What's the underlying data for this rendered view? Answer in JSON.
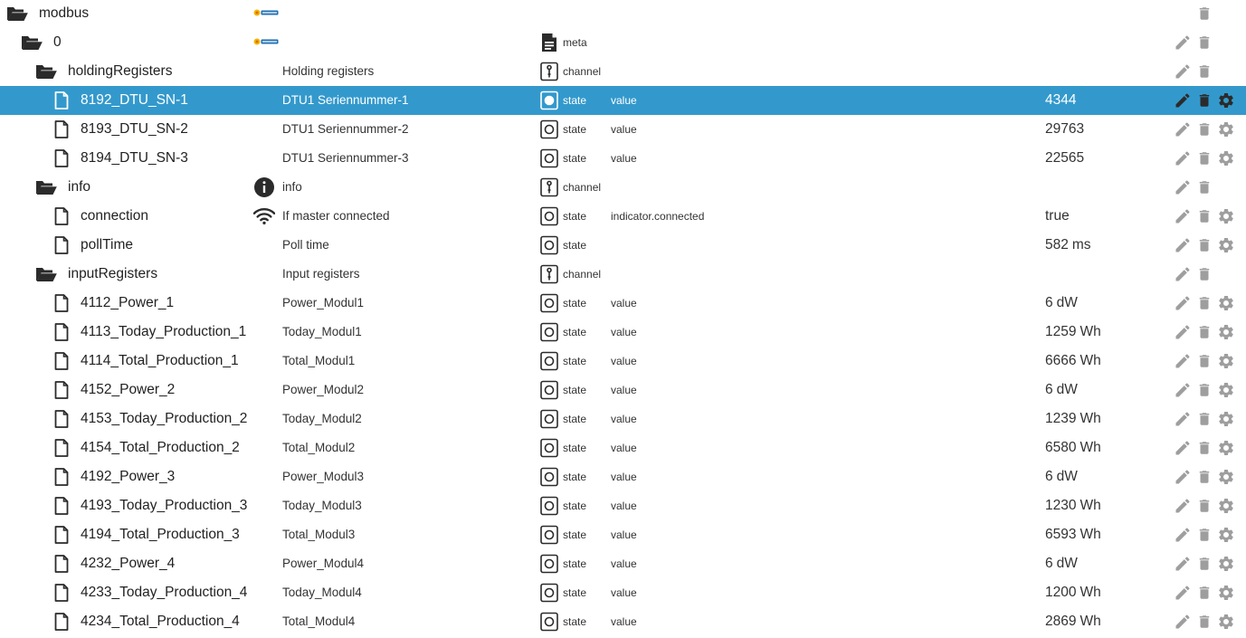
{
  "colors": {
    "selected_bg": "#3399cc",
    "icon": "#2b2b2b",
    "action_icon": "#9e9e9e"
  },
  "rows": [
    {
      "level": 0,
      "kind": "folder",
      "name": "modbus",
      "desc": "",
      "desc_icon": "modbus-logo",
      "type": "",
      "role": "",
      "value": "",
      "unit": "",
      "actions": [
        "delete"
      ],
      "selected": false
    },
    {
      "level": 1,
      "kind": "folder",
      "name": "0",
      "desc": "",
      "desc_icon": "modbus-logo",
      "type": "meta",
      "role": "",
      "value": "",
      "unit": "",
      "actions": [
        "edit",
        "delete"
      ],
      "selected": false
    },
    {
      "level": 2,
      "kind": "folder",
      "name": "holdingRegisters",
      "desc": "Holding registers",
      "desc_icon": "",
      "type": "channel",
      "role": "",
      "value": "",
      "unit": "",
      "actions": [
        "edit",
        "delete"
      ],
      "selected": false
    },
    {
      "level": 3,
      "kind": "file",
      "name": "8192_DTU_SN-1",
      "desc": "DTU1 Seriennummer-1",
      "desc_icon": "",
      "type": "state",
      "role": "value",
      "value": "4344",
      "unit": "",
      "actions": [
        "edit",
        "delete",
        "settings"
      ],
      "selected": true
    },
    {
      "level": 3,
      "kind": "file",
      "name": "8193_DTU_SN-2",
      "desc": "DTU1 Seriennummer-2",
      "desc_icon": "",
      "type": "state",
      "role": "value",
      "value": "29763",
      "unit": "",
      "actions": [
        "edit",
        "delete",
        "settings"
      ],
      "selected": false
    },
    {
      "level": 3,
      "kind": "file",
      "name": "8194_DTU_SN-3",
      "desc": "DTU1 Seriennummer-3",
      "desc_icon": "",
      "type": "state",
      "role": "value",
      "value": "22565",
      "unit": "",
      "actions": [
        "edit",
        "delete",
        "settings"
      ],
      "selected": false
    },
    {
      "level": 2,
      "kind": "folder",
      "name": "info",
      "desc": "info",
      "desc_icon": "info-icon",
      "type": "channel",
      "role": "",
      "value": "",
      "unit": "",
      "actions": [
        "edit",
        "delete"
      ],
      "selected": false
    },
    {
      "level": 3,
      "kind": "file",
      "name": "connection",
      "desc": "If master connected",
      "desc_icon": "wifi-icon",
      "type": "state",
      "role": "indicator.connected",
      "value": "true",
      "unit": "",
      "actions": [
        "edit",
        "delete",
        "settings"
      ],
      "selected": false
    },
    {
      "level": 3,
      "kind": "file",
      "name": "pollTime",
      "desc": "Poll time",
      "desc_icon": "",
      "type": "state",
      "role": "",
      "value": "582",
      "unit": "ms",
      "actions": [
        "edit",
        "delete",
        "settings"
      ],
      "selected": false
    },
    {
      "level": 2,
      "kind": "folder",
      "name": "inputRegisters",
      "desc": "Input registers",
      "desc_icon": "",
      "type": "channel",
      "role": "",
      "value": "",
      "unit": "",
      "actions": [
        "edit",
        "delete"
      ],
      "selected": false
    },
    {
      "level": 3,
      "kind": "file",
      "name": "4112_Power_1",
      "desc": "Power_Modul1",
      "desc_icon": "",
      "type": "state",
      "role": "value",
      "value": "6",
      "unit": "dW",
      "actions": [
        "edit",
        "delete",
        "settings"
      ],
      "selected": false
    },
    {
      "level": 3,
      "kind": "file",
      "name": "4113_Today_Production_1",
      "desc": "Today_Modul1",
      "desc_icon": "",
      "type": "state",
      "role": "value",
      "value": "1259",
      "unit": "Wh",
      "actions": [
        "edit",
        "delete",
        "settings"
      ],
      "selected": false
    },
    {
      "level": 3,
      "kind": "file",
      "name": "4114_Total_Production_1",
      "desc": "Total_Modul1",
      "desc_icon": "",
      "type": "state",
      "role": "value",
      "value": "6666",
      "unit": "Wh",
      "actions": [
        "edit",
        "delete",
        "settings"
      ],
      "selected": false
    },
    {
      "level": 3,
      "kind": "file",
      "name": "4152_Power_2",
      "desc": "Power_Modul2",
      "desc_icon": "",
      "type": "state",
      "role": "value",
      "value": "6",
      "unit": "dW",
      "actions": [
        "edit",
        "delete",
        "settings"
      ],
      "selected": false
    },
    {
      "level": 3,
      "kind": "file",
      "name": "4153_Today_Production_2",
      "desc": "Today_Modul2",
      "desc_icon": "",
      "type": "state",
      "role": "value",
      "value": "1239",
      "unit": "Wh",
      "actions": [
        "edit",
        "delete",
        "settings"
      ],
      "selected": false
    },
    {
      "level": 3,
      "kind": "file",
      "name": "4154_Total_Production_2",
      "desc": "Total_Modul2",
      "desc_icon": "",
      "type": "state",
      "role": "value",
      "value": "6580",
      "unit": "Wh",
      "actions": [
        "edit",
        "delete",
        "settings"
      ],
      "selected": false
    },
    {
      "level": 3,
      "kind": "file",
      "name": "4192_Power_3",
      "desc": "Power_Modul3",
      "desc_icon": "",
      "type": "state",
      "role": "value",
      "value": "6",
      "unit": "dW",
      "actions": [
        "edit",
        "delete",
        "settings"
      ],
      "selected": false
    },
    {
      "level": 3,
      "kind": "file",
      "name": "4193_Today_Production_3",
      "desc": "Today_Modul3",
      "desc_icon": "",
      "type": "state",
      "role": "value",
      "value": "1230",
      "unit": "Wh",
      "actions": [
        "edit",
        "delete",
        "settings"
      ],
      "selected": false
    },
    {
      "level": 3,
      "kind": "file",
      "name": "4194_Total_Production_3",
      "desc": "Total_Modul3",
      "desc_icon": "",
      "type": "state",
      "role": "value",
      "value": "6593",
      "unit": "Wh",
      "actions": [
        "edit",
        "delete",
        "settings"
      ],
      "selected": false
    },
    {
      "level": 3,
      "kind": "file",
      "name": "4232_Power_4",
      "desc": "Power_Modul4",
      "desc_icon": "",
      "type": "state",
      "role": "value",
      "value": "6",
      "unit": "dW",
      "actions": [
        "edit",
        "delete",
        "settings"
      ],
      "selected": false
    },
    {
      "level": 3,
      "kind": "file",
      "name": "4233_Today_Production_4",
      "desc": "Today_Modul4",
      "desc_icon": "",
      "type": "state",
      "role": "value",
      "value": "1200",
      "unit": "Wh",
      "actions": [
        "edit",
        "delete",
        "settings"
      ],
      "selected": false
    },
    {
      "level": 3,
      "kind": "file",
      "name": "4234_Total_Production_4",
      "desc": "Total_Modul4",
      "desc_icon": "",
      "type": "state",
      "role": "value",
      "value": "2869",
      "unit": "Wh",
      "actions": [
        "edit",
        "delete",
        "settings"
      ],
      "selected": false
    }
  ]
}
